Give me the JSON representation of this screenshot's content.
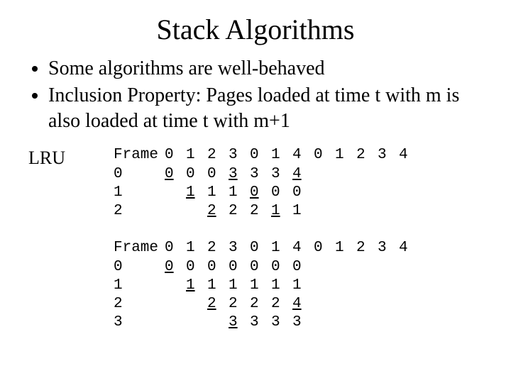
{
  "title": "Stack Algorithms",
  "bullets": [
    "Some algorithms are well-behaved",
    "Inclusion Property: Pages loaded at time t with m is also loaded at time t with m+1"
  ],
  "lru_label": "LRU",
  "table1": {
    "header_label": "Frame",
    "header_vals": [
      "0",
      "1",
      "2",
      "3",
      "0",
      "1",
      "4",
      "0",
      "1",
      "2",
      "3",
      "4"
    ],
    "rows": [
      {
        "label": "0",
        "cells": [
          {
            "v": "0",
            "u": true
          },
          {
            "v": "0"
          },
          {
            "v": "0"
          },
          {
            "v": "3",
            "u": true
          },
          {
            "v": "3"
          },
          {
            "v": "3"
          },
          {
            "v": "4",
            "u": true
          }
        ]
      },
      {
        "label": "1",
        "cells": [
          {
            "v": ""
          },
          {
            "v": "1",
            "u": true
          },
          {
            "v": "1"
          },
          {
            "v": "1"
          },
          {
            "v": "0",
            "u": true
          },
          {
            "v": "0"
          },
          {
            "v": "0"
          }
        ]
      },
      {
        "label": "2",
        "cells": [
          {
            "v": ""
          },
          {
            "v": ""
          },
          {
            "v": "2",
            "u": true
          },
          {
            "v": "2"
          },
          {
            "v": "2"
          },
          {
            "v": "1",
            "u": true
          },
          {
            "v": "1"
          }
        ]
      }
    ]
  },
  "table2": {
    "header_label": "Frame",
    "header_vals": [
      "0",
      "1",
      "2",
      "3",
      "0",
      "1",
      "4",
      "0",
      "1",
      "2",
      "3",
      "4"
    ],
    "rows": [
      {
        "label": "0",
        "cells": [
          {
            "v": "0",
            "u": true
          },
          {
            "v": "0"
          },
          {
            "v": "0"
          },
          {
            "v": "0"
          },
          {
            "v": "0"
          },
          {
            "v": "0"
          },
          {
            "v": "0"
          }
        ]
      },
      {
        "label": "1",
        "cells": [
          {
            "v": ""
          },
          {
            "v": "1",
            "u": true
          },
          {
            "v": "1"
          },
          {
            "v": "1"
          },
          {
            "v": "1"
          },
          {
            "v": "1"
          },
          {
            "v": "1"
          }
        ]
      },
      {
        "label": "2",
        "cells": [
          {
            "v": ""
          },
          {
            "v": ""
          },
          {
            "v": "2",
            "u": true
          },
          {
            "v": "2"
          },
          {
            "v": "2"
          },
          {
            "v": "2"
          },
          {
            "v": "4",
            "u": true
          }
        ]
      },
      {
        "label": "3",
        "cells": [
          {
            "v": ""
          },
          {
            "v": ""
          },
          {
            "v": ""
          },
          {
            "v": "3",
            "u": true
          },
          {
            "v": "3"
          },
          {
            "v": "3"
          },
          {
            "v": "3"
          }
        ]
      }
    ]
  }
}
